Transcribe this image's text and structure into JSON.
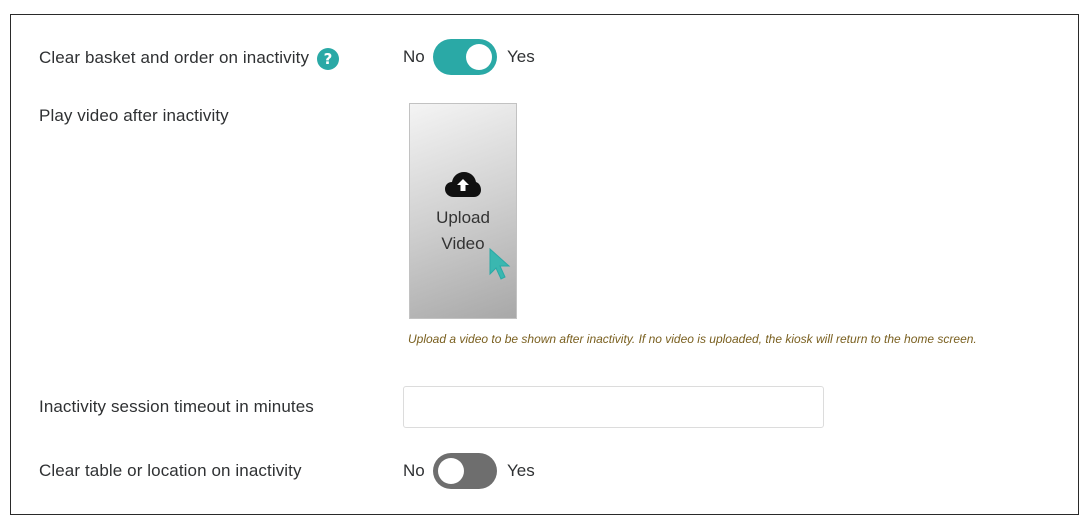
{
  "settings": {
    "clear_basket": {
      "label": "Clear basket and order on inactivity",
      "help_icon": "question-mark-icon",
      "no_label": "No",
      "yes_label": "Yes",
      "value": true
    },
    "play_video": {
      "label": "Play video after inactivity",
      "upload_icon": "cloud-upload-icon",
      "upload_line1": "Upload",
      "upload_line2": "Video",
      "hint": "Upload a video to be shown after inactivity. If no video is uploaded, the kiosk will return to the home screen."
    },
    "timeout": {
      "label": "Inactivity session timeout in minutes",
      "value": "",
      "placeholder": ""
    },
    "clear_table": {
      "label": "Clear table or location on inactivity",
      "no_label": "No",
      "yes_label": "Yes",
      "value": false
    }
  },
  "colors": {
    "accent": "#2aa9a6",
    "toggle_off": "#6e6e6e",
    "hint_text": "#7a6020",
    "label_text": "#2f3133"
  }
}
